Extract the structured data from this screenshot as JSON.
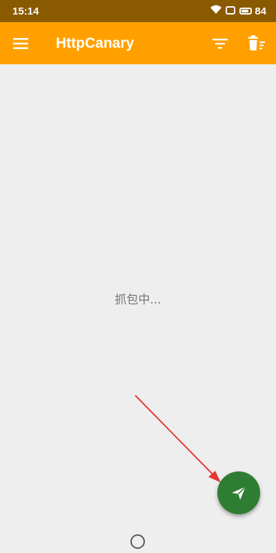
{
  "status_bar": {
    "time": "15:14",
    "battery_level": "84",
    "icons": [
      "wifi-icon",
      "notification-icon",
      "battery-icon"
    ]
  },
  "app_bar": {
    "title": "HttpCanary",
    "icons": [
      "menu-icon",
      "filter-icon",
      "delete-icon"
    ]
  },
  "main": {
    "status_text": "抓包中..."
  },
  "fab": {
    "icon": "send-icon"
  },
  "nav_bar": {
    "icons": [
      "home-icon"
    ]
  },
  "colors": {
    "status_bar": "#8a5a00",
    "app_bar": "#ffa000",
    "background": "#eeeeee",
    "fab": "#2e7d32",
    "annotation_arrow": "#e53935"
  }
}
